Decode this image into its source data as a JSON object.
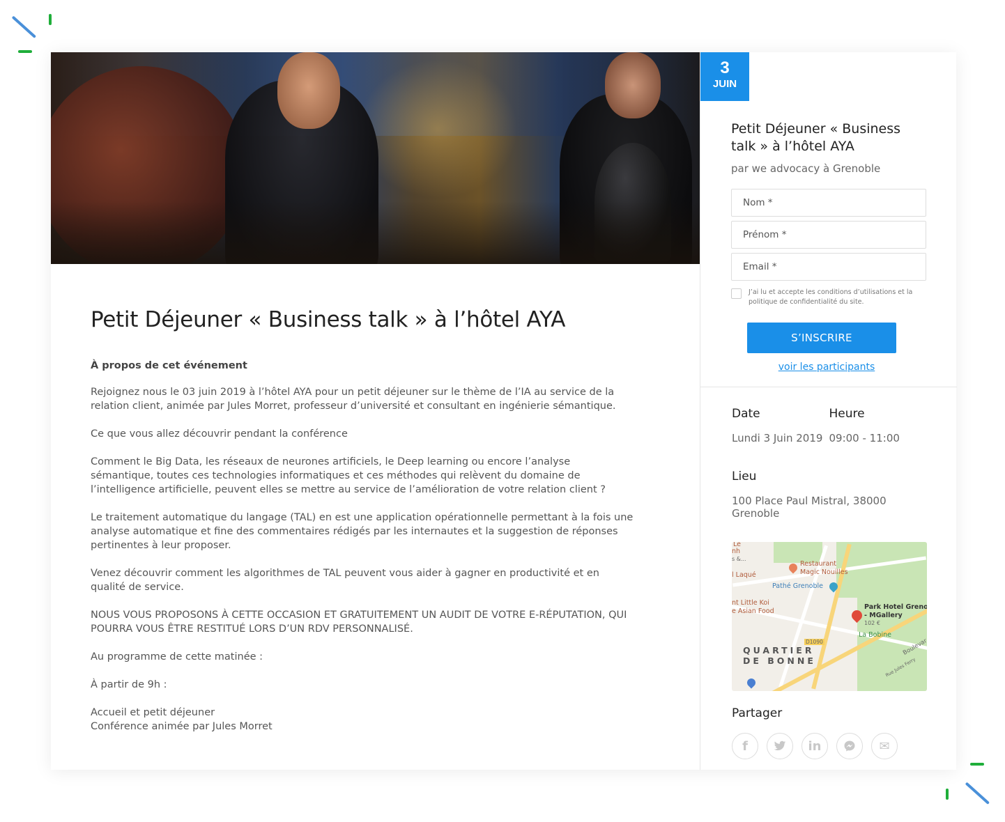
{
  "event": {
    "title": "Petit Déjeuner « Business talk » à l’hôtel AYA",
    "about_heading": "À propos de cet événement",
    "paragraphs": [
      "Rejoignez nous le 03 juin 2019 à l’hôtel AYA pour un petit déjeuner sur le thème de l’IA au service de la relation client, animée par Jules Morret, professeur d’université et consultant en ingénierie sémantique.",
      "Ce que vous allez découvrir pendant la conférence",
      "Comment le Big Data, les réseaux de neurones artificiels, le Deep learning ou encore l’analyse sémantique, toutes ces technologies informatiques et ces méthodes qui relèvent du domaine de l’intelligence artificielle, peuvent elles se mettre au service de l’amélioration de votre relation client ?",
      "Le traitement automatique du langage (TAL) en est une application opérationnelle permettant à la fois une analyse automatique et fine des commentaires rédigés par les internautes et la suggestion de réponses pertinentes à leur proposer.",
      "Venez découvrir comment les algorithmes de TAL peuvent vous aider à gagner en productivité et en qualité de service.",
      "NOUS VOUS PROPOSONS À CETTE OCCASION ET GRATUITEMENT UN AUDIT DE VOTRE E-RÉPUTATION, QUI POURRA VOUS ÊTRE RESTITUÉ LORS D’UN RDV PERSONNALISÉ.",
      "Au programme de cette matinée :",
      "À partir de 9h :"
    ],
    "program": [
      "Accueil et petit déjeuner",
      "Conférence animée par Jules Morret"
    ]
  },
  "badge": {
    "day": "3",
    "month": "JUIN"
  },
  "registration": {
    "title": "Petit Déjeuner « Business talk » à l’hôtel AYA",
    "subtitle": "par we advocacy à Grenoble",
    "fields": {
      "nom": "Nom *",
      "prenom": "Prénom *",
      "email": "Email *"
    },
    "terms": "J’ai lu et accepte les conditions d’utilisations et la politique de confidentialité du site.",
    "button": "S’INSCRIRE",
    "participants_link": "voir les participants"
  },
  "details": {
    "date_label": "Date",
    "date_value": "Lundi 3 Juin 2019",
    "time_label": "Heure",
    "time_value": "09:00 - 11:00",
    "place_label": "Lieu",
    "place_value": "100 Place Paul Mistral, 38000 Grenoble"
  },
  "map": {
    "labels": {
      "le": "Le",
      "nh": "nh",
      "s": "s &...",
      "laque": "l Laqué",
      "restaurant1": "Restaurant",
      "restaurant2": "Magic Nouilles",
      "pathe": "Pathé Grenoble",
      "koi1": "nt Little Koi",
      "koi2": "e Asian Food",
      "park1": "Park Hotel Grenol",
      "park2": "- MGallery",
      "price": "102 €",
      "bobine": "La Bobine",
      "road": "D1090",
      "quartier1": "QUARTIER",
      "quartier2": "DE BONNE",
      "boulevard": "Boulevar",
      "ferry": "Rue Jules Ferry"
    }
  },
  "share": {
    "label": "Partager",
    "icons": [
      "f",
      "t",
      "in",
      "m",
      "✉"
    ]
  },
  "colors": {
    "accent": "#1a8fe8",
    "deco_blue": "#4a90d9",
    "deco_green": "#1fae3a"
  }
}
